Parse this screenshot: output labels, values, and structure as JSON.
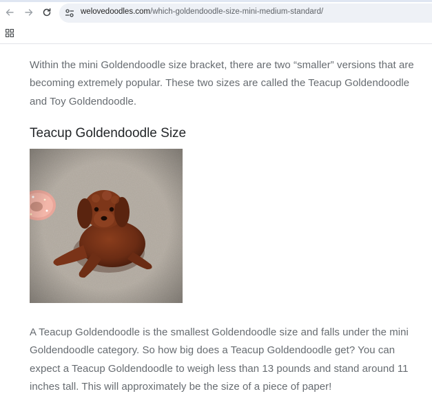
{
  "browser": {
    "url_domain": "welovedoodles.com",
    "url_path": "/which-goldendoodle-size-mini-medium-standard/",
    "icons": {
      "back": "arrow-left-icon",
      "forward": "arrow-right-icon",
      "reload": "reload-icon",
      "site_info": "tune-icon",
      "apps": "apps-grid-icon"
    }
  },
  "article": {
    "intro": "Within the mini Goldendoodle size bracket, there are two “smaller” versions that are becoming extremely popular.  These two sizes are called the Teacup Goldendoodle and Toy Goldendoodle.",
    "heading": "Teacup Goldendoodle Size",
    "image_subject": "brown teacup goldendoodle puppy lying on a carpet next to a pink donut toy",
    "body": "A Teacup Goldendoodle is the smallest Goldendoodle size and falls under the mini Goldendoodle category.  So how big does a Teacup Goldendoodle get? You can expect a Teacup Goldendoodle to weigh less than 13 pounds and stand around 11 inches tall.  This will approximately be the size of a piece of paper!"
  },
  "colors": {
    "body_text": "#666b70",
    "heading_text": "#232629",
    "omnibox_bg": "#eef1f6"
  }
}
